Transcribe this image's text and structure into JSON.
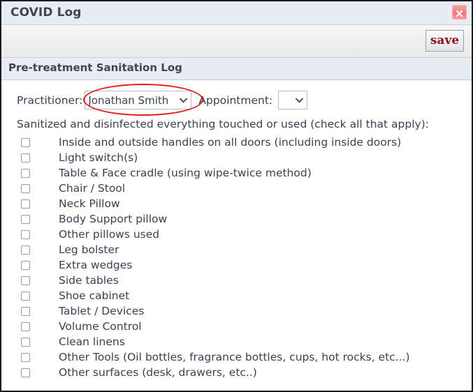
{
  "window": {
    "title": "COVID Log",
    "close_icon": "close-x-icon"
  },
  "toolbar": {
    "save_label": "save"
  },
  "section": {
    "header": "Pre-treatment Sanitation Log"
  },
  "form": {
    "practitioner_label": "Practitioner:",
    "practitioner_value": "Jonathan Smith",
    "appointment_label": "Appointment:",
    "appointment_value": "",
    "instructions": "Sanitized and disinfected everything touched or used (check all that apply):",
    "dropdown_icon": "chevron-down-icon",
    "annotation_color": "#e01b1b"
  },
  "checklist": [
    {
      "label": "Inside and outside handles on all doors (including inside doors)",
      "checked": false
    },
    {
      "label": "Light switch(s)",
      "checked": false
    },
    {
      "label": "Table & Face cradle (using wipe-twice method)",
      "checked": false
    },
    {
      "label": "Chair / Stool",
      "checked": false
    },
    {
      "label": "Neck Pillow",
      "checked": false
    },
    {
      "label": "Body Support pillow",
      "checked": false
    },
    {
      "label": "Other pillows used",
      "checked": false
    },
    {
      "label": "Leg bolster",
      "checked": false
    },
    {
      "label": "Extra wedges",
      "checked": false
    },
    {
      "label": "Side tables",
      "checked": false
    },
    {
      "label": "Shoe cabinet",
      "checked": false
    },
    {
      "label": "Tablet / Devices",
      "checked": false
    },
    {
      "label": "Volume Control",
      "checked": false
    },
    {
      "label": "Clean linens",
      "checked": false
    },
    {
      "label": "Other Tools (Oil bottles, fragrance bottles, cups, hot rocks, etc...)",
      "checked": false
    },
    {
      "label": "Other surfaces (desk, drawers, etc..)",
      "checked": false
    }
  ]
}
